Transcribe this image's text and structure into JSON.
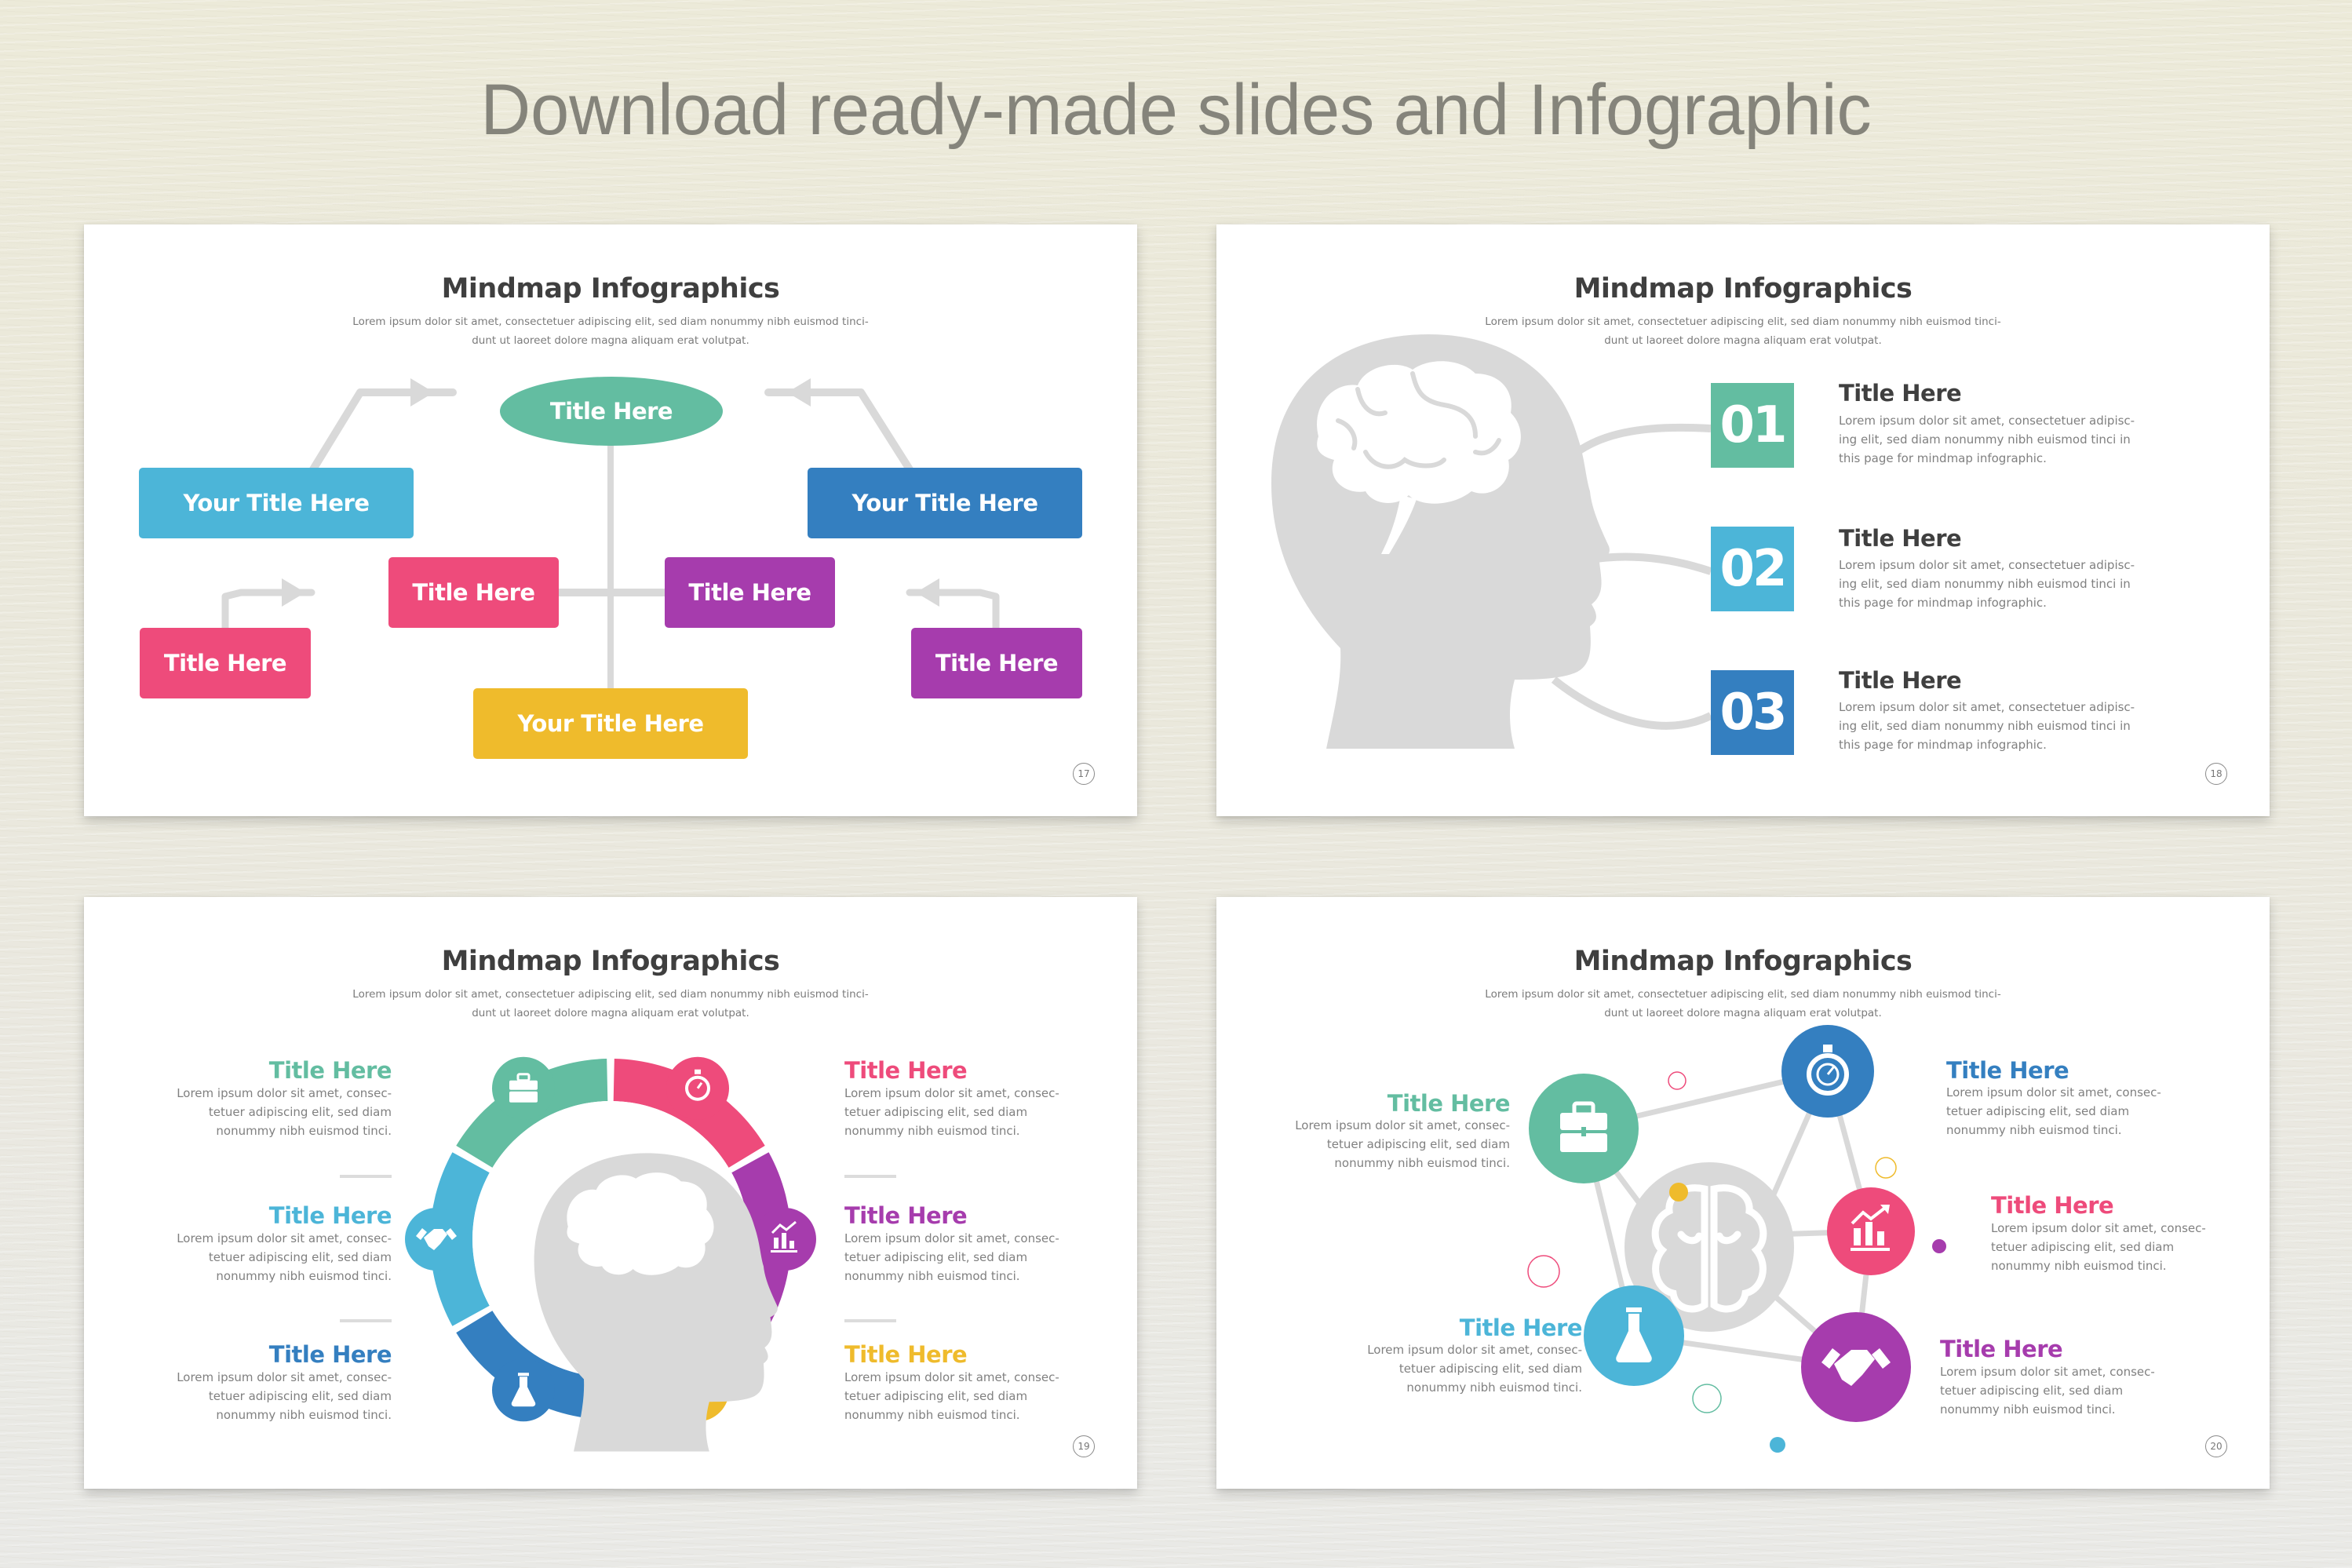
{
  "headline": "Download ready-made slides and Infographic",
  "colors": {
    "teal": "#63bda1",
    "sky": "#4cb5d8",
    "blue": "#347fc0",
    "pink": "#ee4b7b",
    "purple": "#a63cad",
    "yellow": "#efbb2c",
    "gray": "#d9d9d9",
    "title_text": "#3f3f3f",
    "body_text": "#808080",
    "headline_text": "#85847b"
  },
  "slides": [
    {
      "title": "Mindmap Infographics",
      "subtitle_lines": [
        "Lorem ipsum dolor sit amet, consectetuer adipiscing elit, sed diam nonummy nibh euismod tinci-",
        "dunt ut laoreet dolore magna aliquam erat volutpat."
      ],
      "page": "17",
      "nodes": {
        "center": "Title Here",
        "top_left": "Your Title Here",
        "top_right": "Your Title Here",
        "mid_left": "Title Here",
        "mid_right": "Title Here",
        "far_left": "Title Here",
        "far_right": "Title Here",
        "bottom": "Your Title Here"
      }
    },
    {
      "title": "Mindmap Infographics",
      "subtitle_lines": [
        "Lorem ipsum dolor sit amet, consectetuer adipiscing elit, sed diam nonummy nibh euismod tinci-",
        "dunt ut laoreet dolore magna aliquam erat volutpat."
      ],
      "page": "18",
      "items": [
        {
          "number": "01",
          "title": "Title Here",
          "lines": [
            "Lorem ipsum dolor sit amet, consectetuer adipisc-",
            "ing elit, sed diam nonummy nibh euismod tinci in",
            "this page for mindmap infographic."
          ]
        },
        {
          "number": "02",
          "title": "Title Here",
          "lines": [
            "Lorem ipsum dolor sit amet, consectetuer adipisc-",
            "ing elit, sed diam nonummy nibh euismod tinci in",
            "this page for mindmap infographic."
          ]
        },
        {
          "number": "03",
          "title": "Title Here",
          "lines": [
            "Lorem ipsum dolor sit amet, consectetuer adipisc-",
            "ing elit, sed diam nonummy nibh euismod tinci in",
            "this page for mindmap infographic."
          ]
        }
      ]
    },
    {
      "title": "Mindmap Infographics",
      "subtitle_lines": [
        "Lorem ipsum dolor sit amet, consectetuer adipiscing elit, sed diam nonummy nibh euismod tinci-",
        "dunt ut laoreet dolore magna aliquam erat volutpat."
      ],
      "page": "19",
      "left_items": [
        {
          "title": "Title Here",
          "icon": "briefcase-icon",
          "lines": [
            "Lorem ipsum dolor sit amet, consec-",
            "tetuer adipiscing elit, sed diam",
            "nonummy nibh euismod tinci."
          ]
        },
        {
          "title": "Title Here",
          "icon": "handshake-icon",
          "lines": [
            "Lorem ipsum dolor sit amet, consec-",
            "tetuer adipiscing elit, sed diam",
            "nonummy nibh euismod tinci."
          ]
        },
        {
          "title": "Title Here",
          "icon": "flask-icon",
          "lines": [
            "Lorem ipsum dolor sit amet, consec-",
            "tetuer adipiscing elit, sed diam",
            "nonummy nibh euismod tinci."
          ]
        }
      ],
      "right_items": [
        {
          "title": "Title Here",
          "icon": "stopwatch-icon",
          "lines": [
            "Lorem ipsum dolor sit amet, consec-",
            "tetuer adipiscing elit, sed diam",
            "nonummy nibh euismod tinci."
          ]
        },
        {
          "title": "Title Here",
          "icon": "growth-chart-icon",
          "lines": [
            "Lorem ipsum dolor sit amet, consec-",
            "tetuer adipiscing elit, sed diam",
            "nonummy nibh euismod tinci."
          ]
        },
        {
          "title": "Title Here",
          "icon": "diamond-icon",
          "lines": [
            "Lorem ipsum dolor sit amet, consec-",
            "tetuer adipiscing elit, sed diam",
            "nonummy nibh euismod tinci."
          ]
        }
      ]
    },
    {
      "title": "Mindmap Infographics",
      "subtitle_lines": [
        "Lorem ipsum dolor sit amet, consectetuer adipiscing elit, sed diam nonummy nibh euismod tinci-",
        "dunt ut laoreet dolore magna aliquam erat volutpat."
      ],
      "page": "20",
      "items": [
        {
          "title": "Title Here",
          "icon": "briefcase-icon",
          "lines": [
            "Lorem ipsum dolor sit amet, consec-",
            "tetuer adipiscing elit, sed diam",
            "nonummy nibh euismod tinci."
          ]
        },
        {
          "title": "Title Here",
          "icon": "stopwatch-icon",
          "lines": [
            "Lorem ipsum dolor sit amet, consec-",
            "tetuer adipiscing elit, sed diam",
            "nonummy nibh euismod tinci."
          ]
        },
        {
          "title": "Title Here",
          "icon": "growth-chart-icon",
          "lines": [
            "Lorem ipsum dolor sit amet, consec-",
            "tetuer adipiscing elit, sed diam",
            "nonummy nibh euismod tinci."
          ]
        },
        {
          "title": "Title Here",
          "icon": "flask-icon",
          "lines": [
            "Lorem ipsum dolor sit amet, consec-",
            "tetuer adipiscing elit, sed diam",
            "nonummy nibh euismod tinci."
          ]
        },
        {
          "title": "Title Here",
          "icon": "handshake-icon",
          "lines": [
            "Lorem ipsum dolor sit amet, consec-",
            "tetuer adipiscing elit, sed diam",
            "nonummy nibh euismod tinci."
          ]
        }
      ]
    }
  ]
}
